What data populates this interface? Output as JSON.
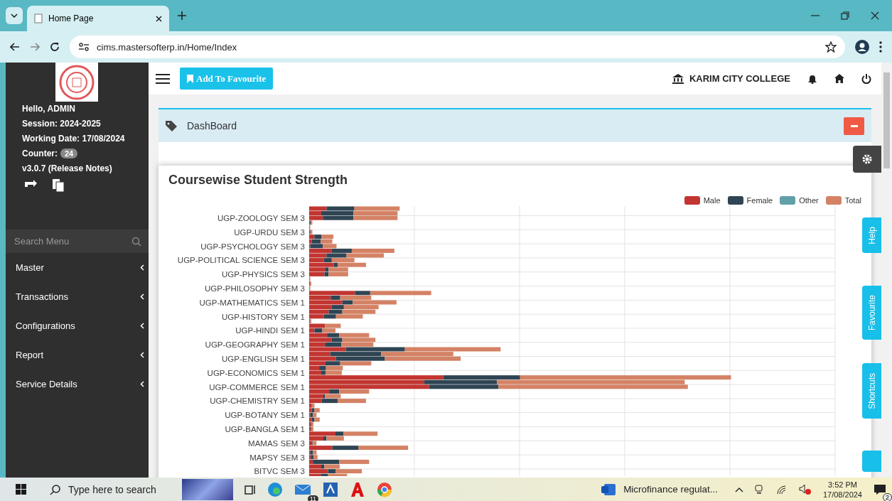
{
  "browser": {
    "tab_title": "Home Page",
    "url": "cims.mastersofterp.in/Home/Index"
  },
  "sidebar": {
    "greeting": "Hello, ADMIN",
    "session": "Session: 2024-2025",
    "working_date": "Working Date: 17/08/2024",
    "counter_label": "Counter:",
    "counter": "24",
    "version": "v3.0.7 (Release Notes)",
    "search": {
      "placeholder": "Search Menu"
    },
    "menu": [
      {
        "label": "Master"
      },
      {
        "label": "Transactions"
      },
      {
        "label": "Configurations"
      },
      {
        "label": "Report"
      },
      {
        "label": "Service Details"
      }
    ]
  },
  "topbar": {
    "favourite_button": "Add To Favourite",
    "college": "KARIM CITY COLLEGE"
  },
  "panel": {
    "title": "DashBoard"
  },
  "chart": {
    "title": "Coursewise Student Strength",
    "legend": [
      {
        "name": "Male",
        "color": "#c23531"
      },
      {
        "name": "Female",
        "color": "#2f4554"
      },
      {
        "name": "Other",
        "color": "#61a0a8"
      },
      {
        "name": "Total",
        "color": "#d48265"
      }
    ],
    "category_labels": [
      "UGP-ZOOLOGY SEM 3",
      "UGP-URDU SEM 3",
      "UGP-PSYCHOLOGY SEM 3",
      "UGP-POLITICAL SCIENCE SEM 3",
      "UGP-PHYSICS SEM 3",
      "UGP-PHILOSOPHY SEM 3",
      "UGP-MATHEMATICS SEM 1",
      "UGP-HISTORY SEM 1",
      "UGP-HINDI SEM 1",
      "UGP-GEOGRAPHY SEM 1",
      "UGP-ENGLISH SEM 1",
      "UGP-ECONOMICS SEM 1",
      "UGP-COMMERCE SEM 1",
      "UGP-CHEMISTRY SEM 1",
      "UGP-BOTANY SEM 1",
      "UGP-BANGLA SEM 1",
      "MAMAS SEM 3",
      "MAPSY SEM 3",
      "BITVC SEM 3"
    ]
  },
  "side_tabs": [
    "Help",
    "Favourite",
    "Shortcuts"
  ],
  "taskbar": {
    "search": {
      "placeholder": "Type here to search"
    },
    "mail_badge": "11",
    "window_title": "Microfinance regulat...",
    "time": "3:52 PM",
    "date": "17/08/2024",
    "notifications": "2"
  }
}
